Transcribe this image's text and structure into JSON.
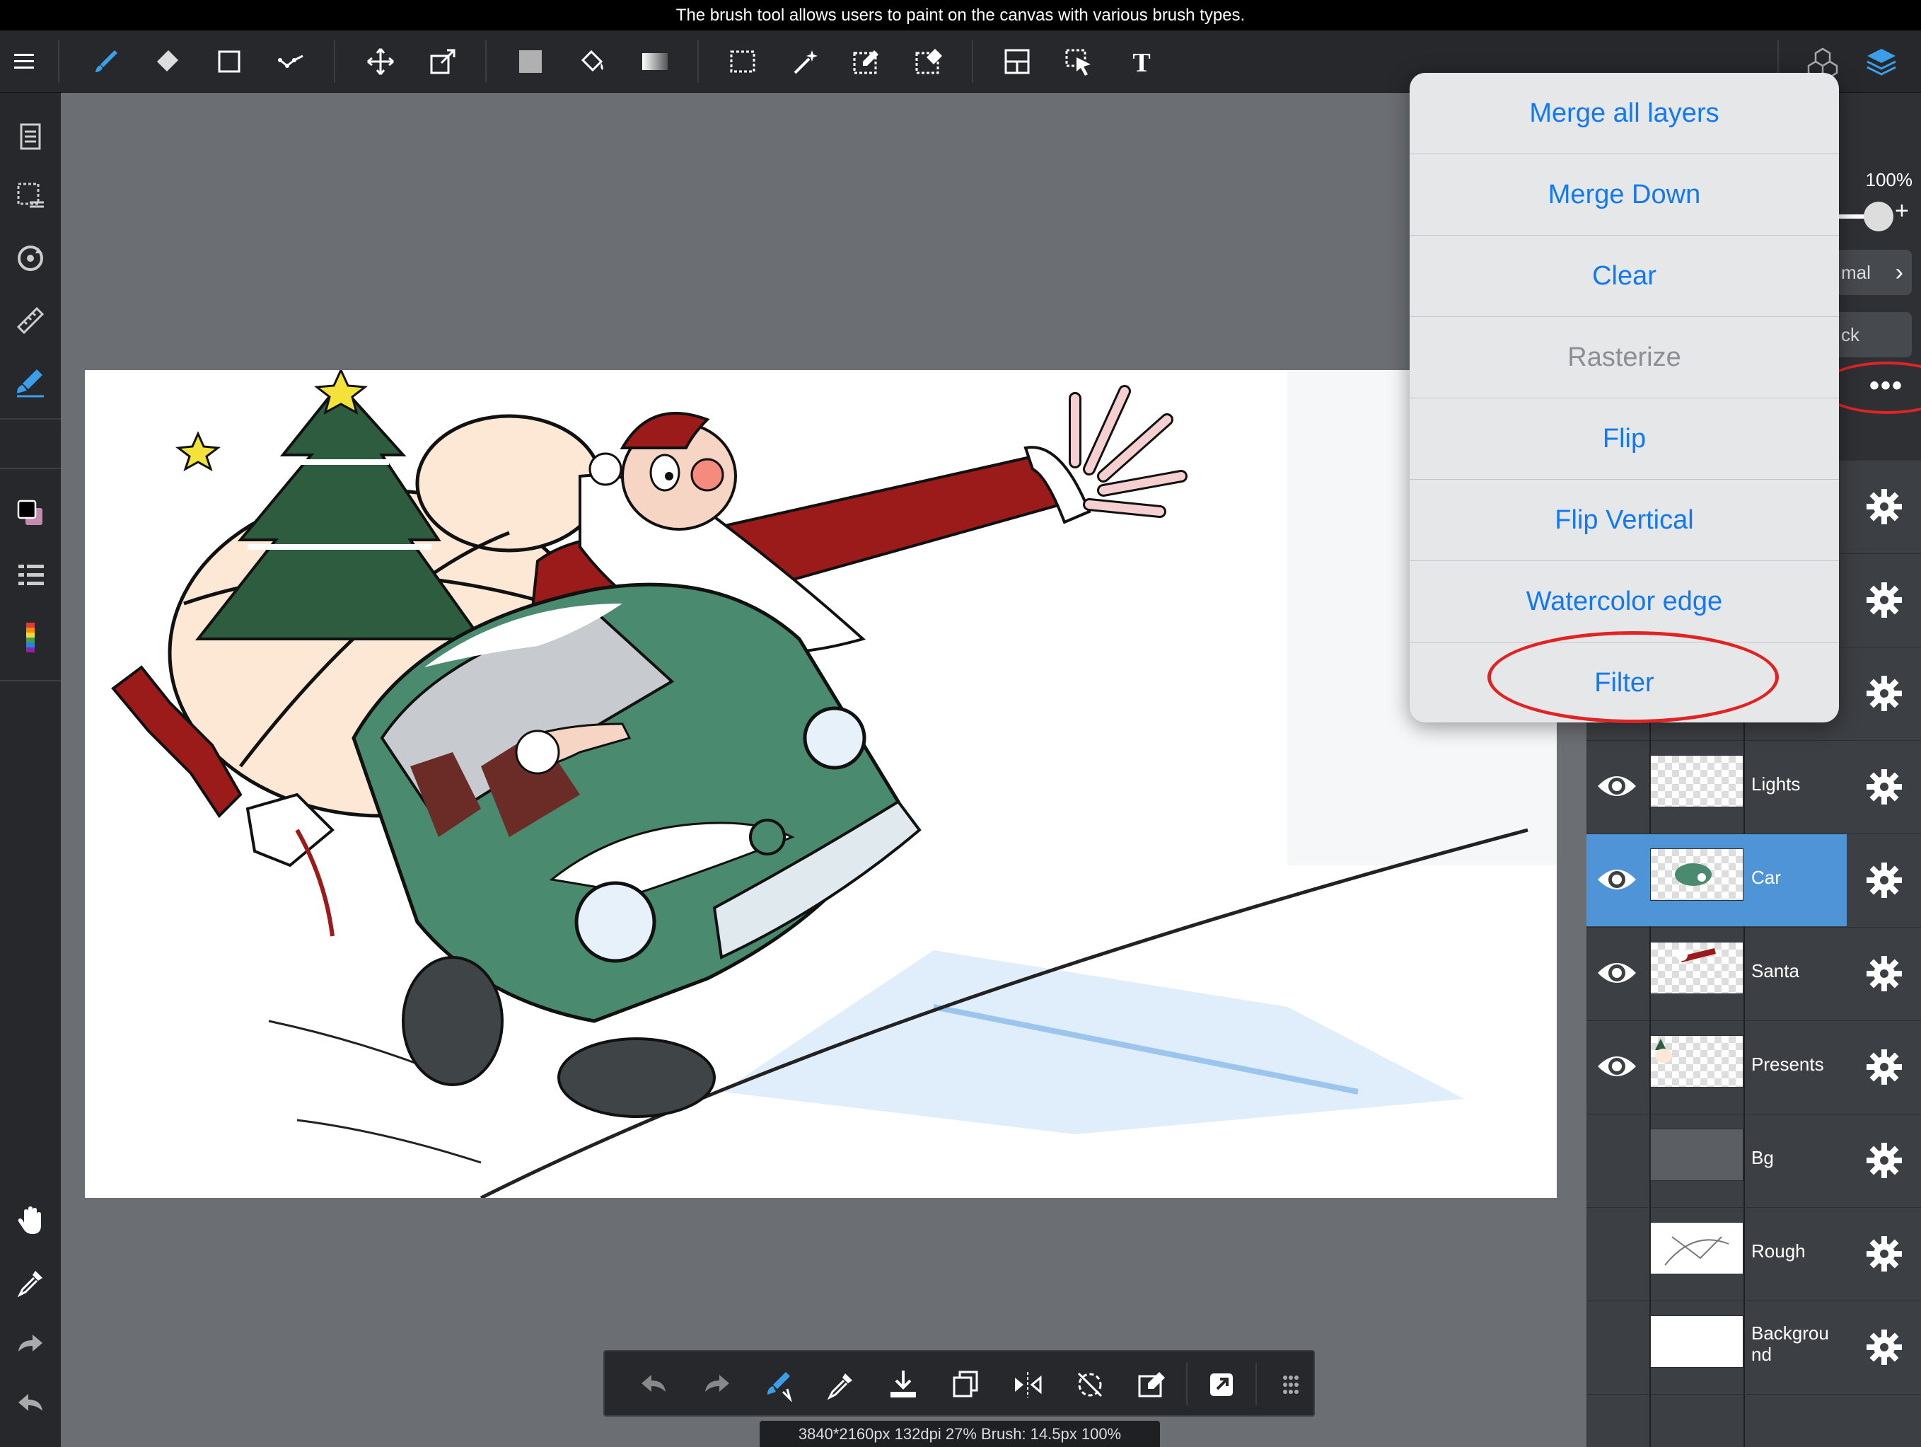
{
  "caption": "The brush tool allows users to paint on the canvas with various brush types.",
  "toolbar": {
    "tools": [
      "menu-icon",
      "brush-icon",
      "eraser-icon",
      "shape-icon",
      "dot-icon",
      "move-icon",
      "transform-icon",
      "fill-color-icon",
      "bucket-icon",
      "gradient-icon",
      "select-rect-icon",
      "magic-wand-icon",
      "select-pen-icon",
      "select-eraser-icon",
      "frame-icon",
      "select-object-icon",
      "text-icon",
      "material-icon",
      "layers-icon"
    ]
  },
  "panel": {
    "opacity_label": "100%",
    "opacity": 1.0,
    "blend_mode": "mal",
    "lock_label": "ck",
    "more_label": "•••"
  },
  "layers": [
    {
      "name": "",
      "visible": false
    },
    {
      "name": "",
      "visible": false
    },
    {
      "name": "",
      "visible": false
    },
    {
      "name": "Lights",
      "visible": true
    },
    {
      "name": "Car",
      "visible": true,
      "selected": true
    },
    {
      "name": "Santa",
      "visible": true
    },
    {
      "name": "Presents",
      "visible": true
    },
    {
      "name": "Bg",
      "visible": false
    },
    {
      "name": "Rough",
      "visible": false
    },
    {
      "name": "Backgrou\nnd",
      "visible": false
    }
  ],
  "menu": {
    "items": [
      {
        "label": "Merge all layers",
        "enabled": true
      },
      {
        "label": "Merge Down",
        "enabled": true
      },
      {
        "label": "Clear",
        "enabled": true
      },
      {
        "label": "Rasterize",
        "enabled": false
      },
      {
        "label": "Flip",
        "enabled": true
      },
      {
        "label": "Flip Vertical",
        "enabled": true
      },
      {
        "label": "Watercolor edge",
        "enabled": true
      },
      {
        "label": "Filter",
        "enabled": true
      }
    ]
  },
  "status": "3840*2160px 132dpi 27% Brush: 14.5px 100%",
  "colors": {
    "accent": "#1479f0",
    "selected_layer": "#4f94d6",
    "highlight": "#e02424",
    "car_green": "#4a8a6e",
    "santa_red": "#9b1a1a"
  }
}
